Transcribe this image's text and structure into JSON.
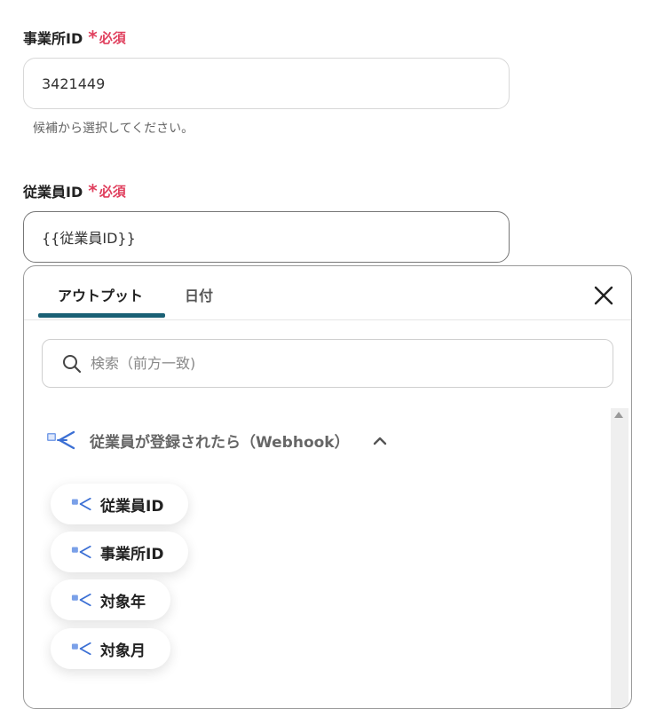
{
  "office_field": {
    "label": "事業所ID",
    "required_mark": "*",
    "required_text": "必須",
    "value": "3421449",
    "hint": "候補から選択してください。"
  },
  "employee_field": {
    "label": "従業員ID",
    "required_mark": "*",
    "required_text": "必須",
    "value": "{{従業員ID}}"
  },
  "panel": {
    "tabs": [
      {
        "label": "アウトプット",
        "active": true
      },
      {
        "label": "日付",
        "active": false
      }
    ],
    "close_icon": "close-icon",
    "search": {
      "placeholder": "検索（前方一致)",
      "icon": "search-icon"
    },
    "group": {
      "title": "従業員が登録されたら（Webhook）",
      "icon": "app-icon",
      "expanded": true,
      "items": [
        {
          "label": "従業員ID"
        },
        {
          "label": "事業所ID"
        },
        {
          "label": "対象年"
        },
        {
          "label": "対象月"
        }
      ]
    }
  },
  "colors": {
    "required": "#e0405e",
    "tab_indicator": "#1a6075",
    "icon_blue": "#3b6fd4"
  }
}
